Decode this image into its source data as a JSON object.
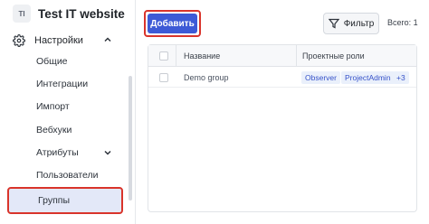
{
  "workspace": {
    "badge": "TI",
    "name": "Test IT website"
  },
  "sidebar": {
    "section": {
      "label": "Настройки",
      "icon": "gear-icon",
      "expanded": true
    },
    "items": [
      {
        "label": "Общие"
      },
      {
        "label": "Интеграции"
      },
      {
        "label": "Импорт"
      },
      {
        "label": "Вебхуки"
      },
      {
        "label": "Атрибуты",
        "has_submenu": true
      },
      {
        "label": "Пользователи"
      },
      {
        "label": "Группы",
        "active": true
      }
    ]
  },
  "toolbar": {
    "add_label": "Добавить",
    "filter_label": "Фильтр",
    "total_label": "Всего: 1"
  },
  "table": {
    "columns": [
      "Название",
      "Проектные роли"
    ],
    "rows": [
      {
        "name": "Demo group",
        "roles": [
          "Observer",
          "ProjectAdmin"
        ],
        "more": "+3"
      }
    ]
  },
  "colors": {
    "accent": "#3d5ad6",
    "highlight_outline": "#d9342b",
    "active_item_bg": "#e3e8f8",
    "tag_bg": "#eaf0fb",
    "tag_text": "#3652c9"
  }
}
